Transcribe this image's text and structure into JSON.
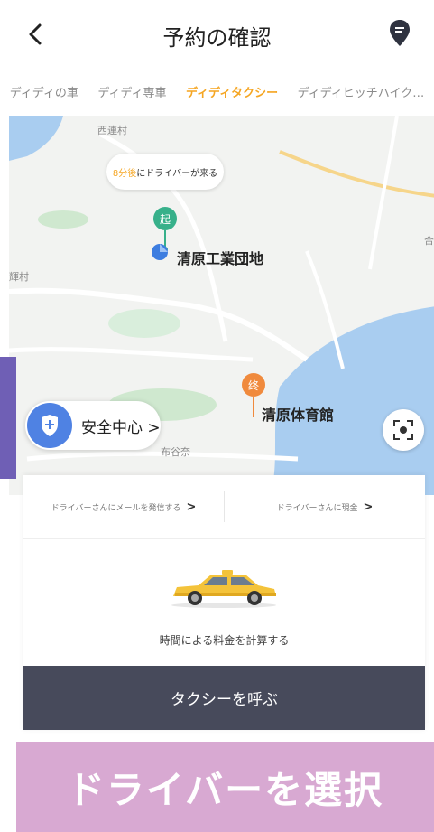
{
  "header": {
    "title": "予約の確認"
  },
  "tabs": [
    {
      "label": "ディディの車",
      "active": false
    },
    {
      "label": "ディディ専車",
      "active": false
    },
    {
      "label": "ディディタクシー",
      "active": true
    },
    {
      "label": "ディディヒッチハイク…",
      "active": false
    }
  ],
  "map": {
    "bubble_time": "8分後",
    "bubble_text": "にドライバーが来る",
    "pickup_marker": "起",
    "pickup_label": "清原工業団地",
    "dest_marker": "终",
    "dest_label": "清原体育館",
    "village_top": "西連村",
    "village_left": "輝村",
    "village_bottom": "布谷奈",
    "right_edge": "合"
  },
  "safety": {
    "label": "安全中心 >"
  },
  "card": {
    "link_left": "ドライバーさんにメールを発信する",
    "link_left_arrow": ">",
    "link_right": "ドライバーさんに現金",
    "link_right_arrow": ">",
    "calc_label": "時間による料金を計算する",
    "call_button": "タクシーを呼ぶ"
  },
  "banner": {
    "text": "ドライバーを選択"
  },
  "colors": {
    "accent": "#f5a623",
    "pickup": "#37b08a",
    "destination": "#f08a3d",
    "safety": "#4f82e3",
    "button_bg": "#474a5b",
    "banner_bg": "#d8a9d2"
  },
  "icons": {
    "back": "chevron-left-icon",
    "header_right": "location-pin-icon",
    "safety": "shield-plus-icon",
    "locate": "locate-icon",
    "taxi": "taxi-icon"
  }
}
